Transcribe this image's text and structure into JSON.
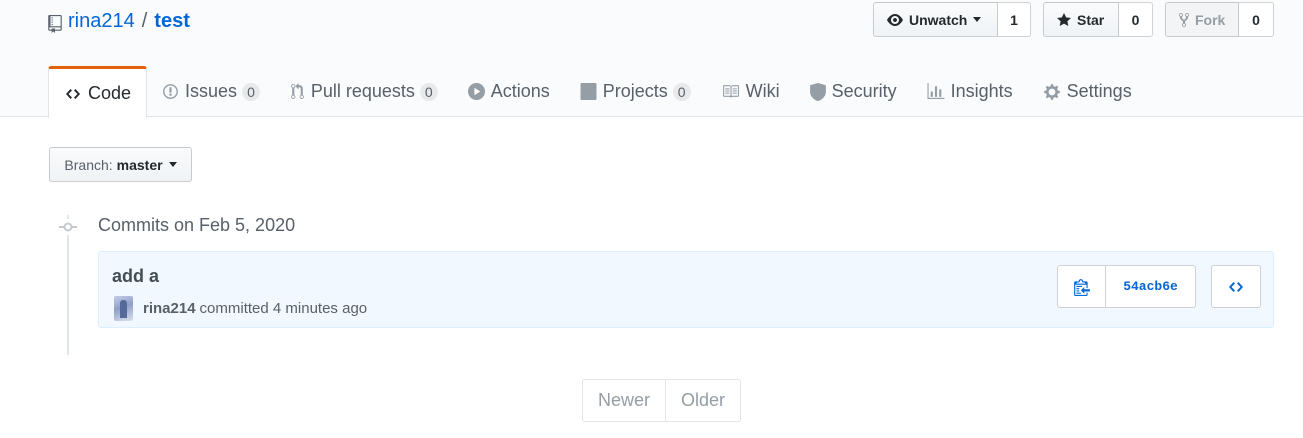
{
  "repo": {
    "owner": "rina214",
    "separator": "/",
    "name": "test"
  },
  "actions": {
    "watch": {
      "label": "Unwatch",
      "count": "1"
    },
    "star": {
      "label": "Star",
      "count": "0"
    },
    "fork": {
      "label": "Fork",
      "count": "0"
    }
  },
  "tabs": [
    {
      "label": "Code",
      "icon": "code-icon",
      "selected": true
    },
    {
      "label": "Issues",
      "icon": "issue-opened-icon",
      "counter": "0"
    },
    {
      "label": "Pull requests",
      "icon": "git-pull-request-icon",
      "counter": "0"
    },
    {
      "label": "Actions",
      "icon": "play-icon"
    },
    {
      "label": "Projects",
      "icon": "project-icon",
      "counter": "0"
    },
    {
      "label": "Wiki",
      "icon": "book-icon"
    },
    {
      "label": "Security",
      "icon": "shield-icon"
    },
    {
      "label": "Insights",
      "icon": "graph-icon"
    },
    {
      "label": "Settings",
      "icon": "gear-icon"
    }
  ],
  "branch": {
    "label": "Branch:",
    "value": "master"
  },
  "commit_group": {
    "title": "Commits on Feb 5, 2020"
  },
  "commit": {
    "message": "add a",
    "author": "rina214",
    "action": "committed 4 minutes ago",
    "sha": "54acb6e"
  },
  "pagination": {
    "newer": "Newer",
    "older": "Older"
  },
  "colors": {
    "link": "#0366d6",
    "tab_accent": "#e36209",
    "commit_bg": "#f1f8ff"
  }
}
